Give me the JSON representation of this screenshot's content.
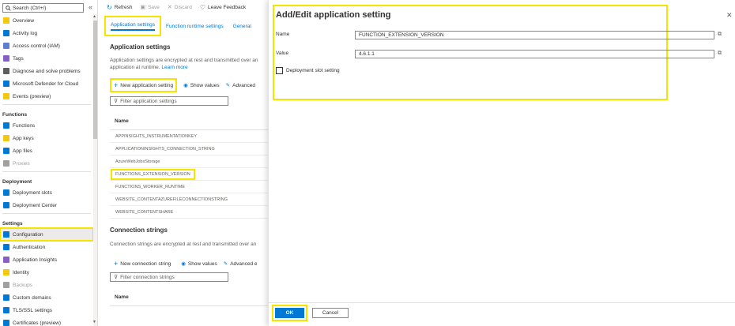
{
  "sidebar": {
    "search_placeholder": "Search (Ctrl+/)",
    "collapse": "«",
    "items": [
      {
        "label": "Overview",
        "icon": "lightning-icon",
        "color": "#f2c811"
      },
      {
        "label": "Activity log",
        "icon": "activity-log-icon",
        "color": "#0078d4"
      },
      {
        "label": "Access control (IAM)",
        "icon": "people-icon",
        "color": "#5c7ed1"
      },
      {
        "label": "Tags",
        "icon": "tag-icon",
        "color": "#8661c5"
      },
      {
        "label": "Diagnose and solve problems",
        "icon": "wrench-icon",
        "color": "#605e5c"
      },
      {
        "label": "Microsoft Defender for Cloud",
        "icon": "shield-icon",
        "color": "#0078d4"
      },
      {
        "label": "Events (preview)",
        "icon": "bolt-icon",
        "color": "#f2c811"
      }
    ],
    "section_functions": "Functions",
    "functions_items": [
      {
        "label": "Functions",
        "icon": "functions-icon",
        "color": "#0078d4"
      },
      {
        "label": "App keys",
        "icon": "key-icon",
        "color": "#f2c811"
      },
      {
        "label": "App files",
        "icon": "files-icon",
        "color": "#0078d4"
      },
      {
        "label": "Proxies",
        "icon": "proxy-icon",
        "color": "#a19f9d"
      }
    ],
    "section_deployment": "Deployment",
    "deployment_items": [
      {
        "label": "Deployment slots",
        "icon": "slots-icon",
        "color": "#0078d4"
      },
      {
        "label": "Deployment Center",
        "icon": "center-icon",
        "color": "#0078d4"
      }
    ],
    "section_settings": "Settings",
    "settings_items": [
      {
        "label": "Configuration",
        "icon": "configuration-icon",
        "color": "#0078d4"
      },
      {
        "label": "Authentication",
        "icon": "person-icon",
        "color": "#0078d4"
      },
      {
        "label": "Application Insights",
        "icon": "lightbulb-icon",
        "color": "#8661c5"
      },
      {
        "label": "Identity",
        "icon": "identity-icon",
        "color": "#f2c811"
      },
      {
        "label": "Backups",
        "icon": "backup-icon",
        "color": "#a19f9d"
      },
      {
        "label": "Custom domains",
        "icon": "globe-icon",
        "color": "#0078d4"
      },
      {
        "label": "TLS/SSL settings",
        "icon": "lock-icon",
        "color": "#0078d4"
      },
      {
        "label": "Certificates (preview)",
        "icon": "certificate-icon",
        "color": "#0078d4"
      }
    ]
  },
  "toolbar": {
    "refresh": "Refresh",
    "save": "Save",
    "discard": "Discard",
    "feedback": "Leave Feedback"
  },
  "tabs": [
    {
      "label": "Application settings"
    },
    {
      "label": "Function runtime settings"
    },
    {
      "label": "General"
    }
  ],
  "app_settings": {
    "heading": "Application settings",
    "desc_line1": "Application settings are encrypted at rest and transmitted over an",
    "desc_line2": "application at runtime.",
    "learn_more": "Learn more",
    "new_btn": "New application setting",
    "show_values": "Show values",
    "advanced": "Advanced",
    "filter_placeholder": "Filter application settings",
    "col_name": "Name",
    "rows": [
      "APPINSIGHTS_INSTRUMENTATIONKEY",
      "APPLICATIONINSIGHTS_CONNECTION_STRING",
      "AzureWebJobsStorage",
      "FUNCTIONS_EXTENSION_VERSION",
      "FUNCTIONS_WORKER_RUNTIME",
      "WEBSITE_CONTENTAZUREFILECONNECTIONSTRING",
      "WEBSITE_CONTENTSHARE"
    ]
  },
  "conn_strings": {
    "heading": "Connection strings",
    "desc_line1": "Connection strings are encrypted at rest and transmitted over an",
    "new_btn": "New connection string",
    "show_values": "Show values",
    "advanced": "Advanced e",
    "filter_placeholder": "Filter connection strings",
    "col_name": "Name"
  },
  "panel": {
    "title": "Add/Edit application setting",
    "name_label": "Name",
    "name_value": "FUNCTION_EXTENSION_VERSION",
    "value_label": "Value",
    "value_value": "4.6.1.1",
    "slot_label": "Deployment slot setting",
    "ok": "OK",
    "cancel": "Cancel"
  },
  "colors": {
    "accent": "#0078d4",
    "highlight": "#f5e400"
  }
}
